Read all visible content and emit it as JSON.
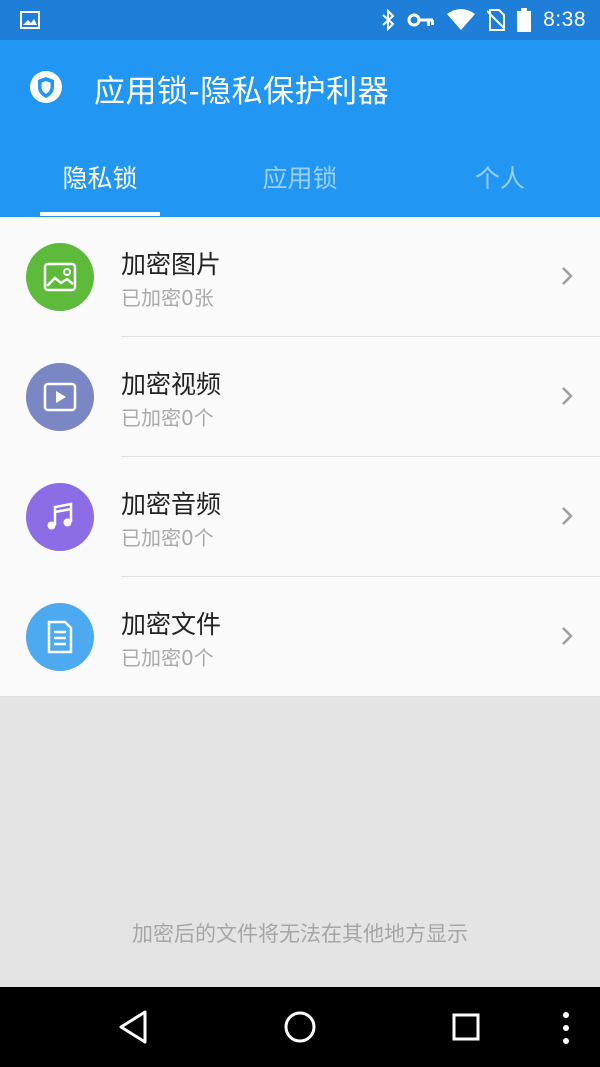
{
  "status_bar": {
    "time": "8:38",
    "icons": [
      "image-icon",
      "bluetooth-icon",
      "key-icon",
      "wifi-icon",
      "no-sim-icon",
      "battery-icon"
    ]
  },
  "app_bar": {
    "title": "应用锁-隐私保护利器",
    "icon": "shield-icon",
    "color": "#2196f3"
  },
  "tabs": [
    {
      "label": "隐私锁",
      "active": true
    },
    {
      "label": "应用锁",
      "active": false
    },
    {
      "label": "个人",
      "active": false
    }
  ],
  "items": [
    {
      "title": "加密图片",
      "subtitle": "已加密0张",
      "icon": "image-icon",
      "color": "#5dba3b"
    },
    {
      "title": "加密视频",
      "subtitle": "已加密0个",
      "icon": "play-icon",
      "color": "#7b86c4"
    },
    {
      "title": "加密音频",
      "subtitle": "已加密0个",
      "icon": "music-note-icon",
      "color": "#8b6de6"
    },
    {
      "title": "加密文件",
      "subtitle": "已加密0个",
      "icon": "document-icon",
      "color": "#4da9f0"
    }
  ],
  "footer_note": "加密后的文件将无法在其他地方显示",
  "nav_bar": {
    "buttons": [
      "back-icon",
      "home-icon",
      "recents-icon",
      "more-icon"
    ]
  }
}
